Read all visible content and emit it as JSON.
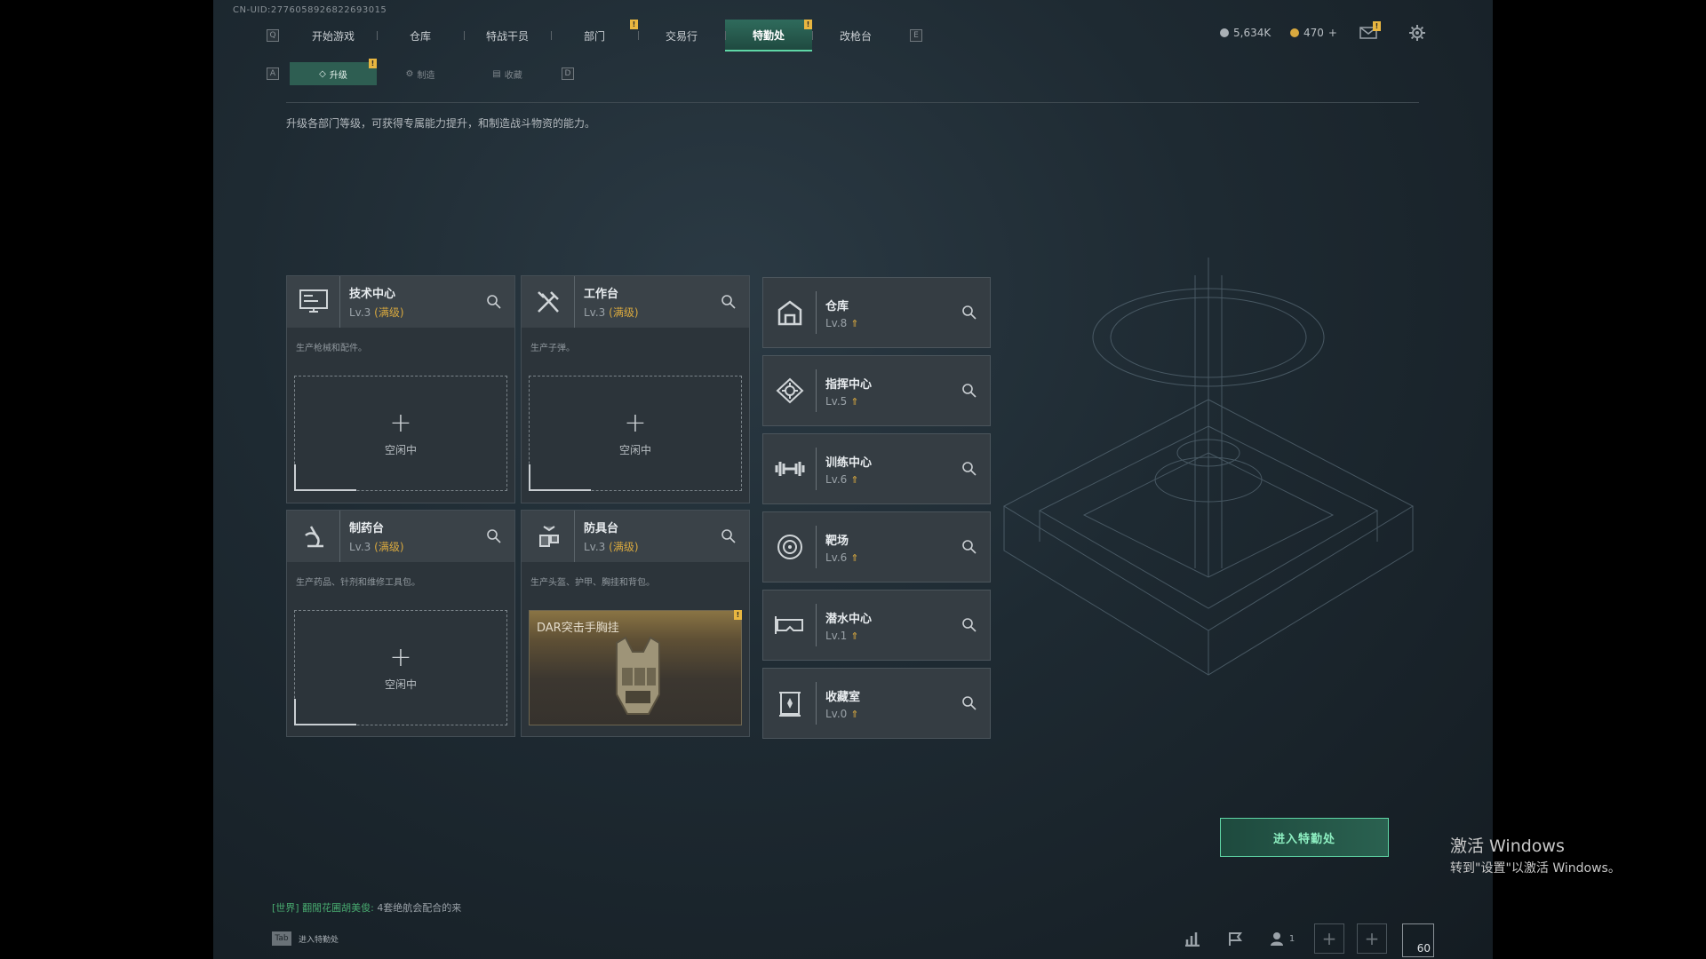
{
  "uid": "CN-UID:2776058926822693015",
  "nav": {
    "key_left": "Q",
    "key_right": "E",
    "tabs": [
      {
        "label": "开始游戏"
      },
      {
        "label": "仓库"
      },
      {
        "label": "特战干员"
      },
      {
        "label": "部门",
        "notif": "!"
      },
      {
        "label": "交易行"
      },
      {
        "label": "特勤处",
        "active": true,
        "notif": "!"
      },
      {
        "label": "改枪台"
      }
    ]
  },
  "currency": {
    "primary": "5,634K",
    "secondary": "470",
    "add": "+"
  },
  "mail_notif": "!",
  "subnav": {
    "key_left": "A",
    "key_right": "D",
    "tabs": [
      {
        "label": "升级",
        "active": true,
        "notif": "!"
      },
      {
        "label": "制造"
      },
      {
        "label": "收藏"
      }
    ]
  },
  "description": "升级各部门等级，可获得专属能力提升，和制造战斗物资的能力。",
  "stations": [
    {
      "name": "技术中心",
      "level": "Lv.3",
      "max": "(满级)",
      "desc": "生产枪械和配件。",
      "slot": "空闲中",
      "icon": "computer-icon"
    },
    {
      "name": "工作台",
      "level": "Lv.3",
      "max": "(满级)",
      "desc": "生产子弹。",
      "slot": "空闲中",
      "icon": "tools-icon"
    },
    {
      "name": "制药台",
      "level": "Lv.3",
      "max": "(满级)",
      "desc": "生产药品、针剂和维修工具包。",
      "slot": "空闲中",
      "icon": "microscope-icon"
    },
    {
      "name": "防具台",
      "level": "Lv.3",
      "max": "(满级)",
      "desc": "生产头盔、护甲、胸挂和背包。",
      "item": "DAR突击手胸挂",
      "item_notif": "!",
      "icon": "armor-icon"
    }
  ],
  "departments": [
    {
      "name": "仓库",
      "level": "Lv.8",
      "icon": "warehouse-icon"
    },
    {
      "name": "指挥中心",
      "level": "Lv.5",
      "icon": "command-icon"
    },
    {
      "name": "训练中心",
      "level": "Lv.6",
      "icon": "dumbbell-icon"
    },
    {
      "name": "靶场",
      "level": "Lv.6",
      "icon": "target-icon"
    },
    {
      "name": "潜水中心",
      "level": "Lv.1",
      "icon": "diving-mask-icon"
    },
    {
      "name": "收藏室",
      "level": "Lv.0",
      "icon": "trophy-icon"
    }
  ],
  "enter_button": "进入特勤处",
  "chat": {
    "channel": "[世界]",
    "user": "翻閒花圃胡美俊:",
    "message": "4套绝航会配合的来"
  },
  "tab_hint": {
    "key": "Tab",
    "label": "进入特勤处"
  },
  "bottom": {
    "friends_count": "1",
    "fps": "60"
  },
  "watermark": {
    "line1": "激活 Windows",
    "line2": "转到\"设置\"以激活 Windows。"
  }
}
